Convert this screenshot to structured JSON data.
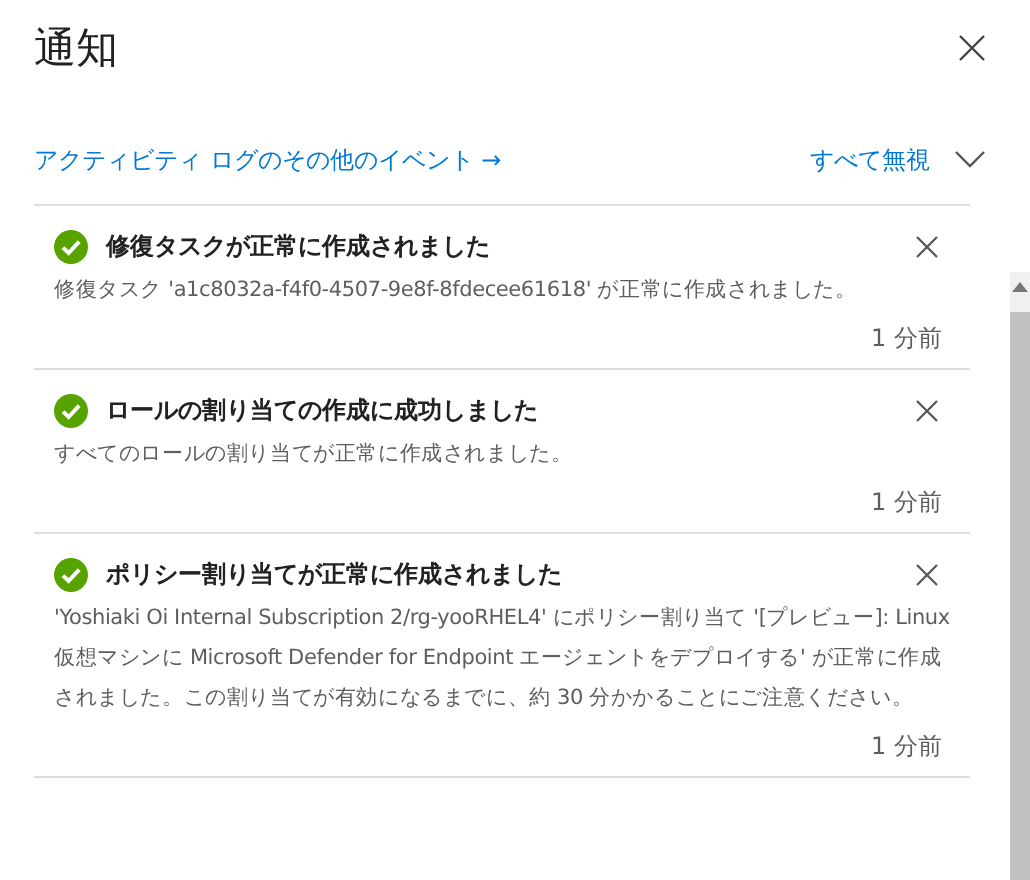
{
  "panel": {
    "title": "通知"
  },
  "activity_link": "アクティビティ ログのその他のイベント →",
  "dismiss_all": {
    "label": "すべて無視",
    "expanded": false
  },
  "notifications": [
    {
      "kind": "success",
      "title": "修復タスクが正常に作成されました",
      "message": "修復タスク 'a1c8032a-f4f0-4507-9e8f-8fdecee61618' が正常に作成されました。",
      "time": "1 分前"
    },
    {
      "kind": "success",
      "title": "ロールの割り当ての作成に成功しました",
      "message": "すべてのロールの割り当てが正常に作成されました。",
      "time": "1 分前"
    },
    {
      "kind": "success",
      "title": "ポリシー割り当てが正常に作成されました",
      "message": "'Yoshiaki Oi Internal Subscription 2/rg-yooRHEL4' にポリシー割り当て '[プレビュー]: Linux 仮想マシンに Microsoft Defender for Endpoint エージェントをデプロイする' が正常に作成されました。この割り当てが有効になるまでに、約 30 分かかることにご注意ください。",
      "time": "1 分前"
    }
  ]
}
